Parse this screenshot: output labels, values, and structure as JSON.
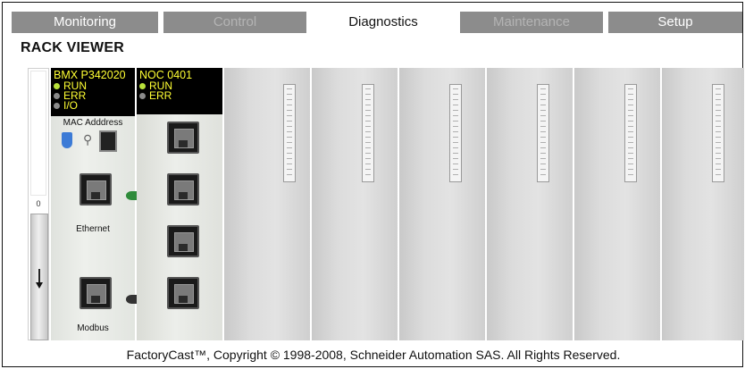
{
  "tabs": [
    {
      "label": "Monitoring"
    },
    {
      "label": "Control"
    },
    {
      "label": "Diagnostics"
    },
    {
      "label": "Maintenance"
    },
    {
      "label": "Setup"
    }
  ],
  "section_title": "RACK VIEWER",
  "scroll": {
    "position_label": "0"
  },
  "modules": {
    "cpu": {
      "model": "BMX P342020",
      "leds": [
        {
          "label": "RUN",
          "state": "on"
        },
        {
          "label": "ERR",
          "state": "off"
        },
        {
          "label": "I/O",
          "state": "off"
        }
      ],
      "mac_label": "MAC Adddress",
      "ethernet_label": "Ethernet",
      "modbus_label": "Modbus"
    },
    "noc": {
      "model": "NOC 0401",
      "leds": [
        {
          "label": "RUN",
          "state": "on"
        },
        {
          "label": "ERR",
          "state": "off"
        }
      ]
    }
  },
  "colors": {
    "tab_inactive": "#8c8c8c",
    "tab_active": "#ffffff",
    "led_on": "#b8e13a",
    "led_off": "#8a8a8a",
    "module_header_text": "#ffff33"
  },
  "footer": "FactoryCast™, Copyright © 1998-2008, Schneider Automation SAS. All Rights Reserved."
}
